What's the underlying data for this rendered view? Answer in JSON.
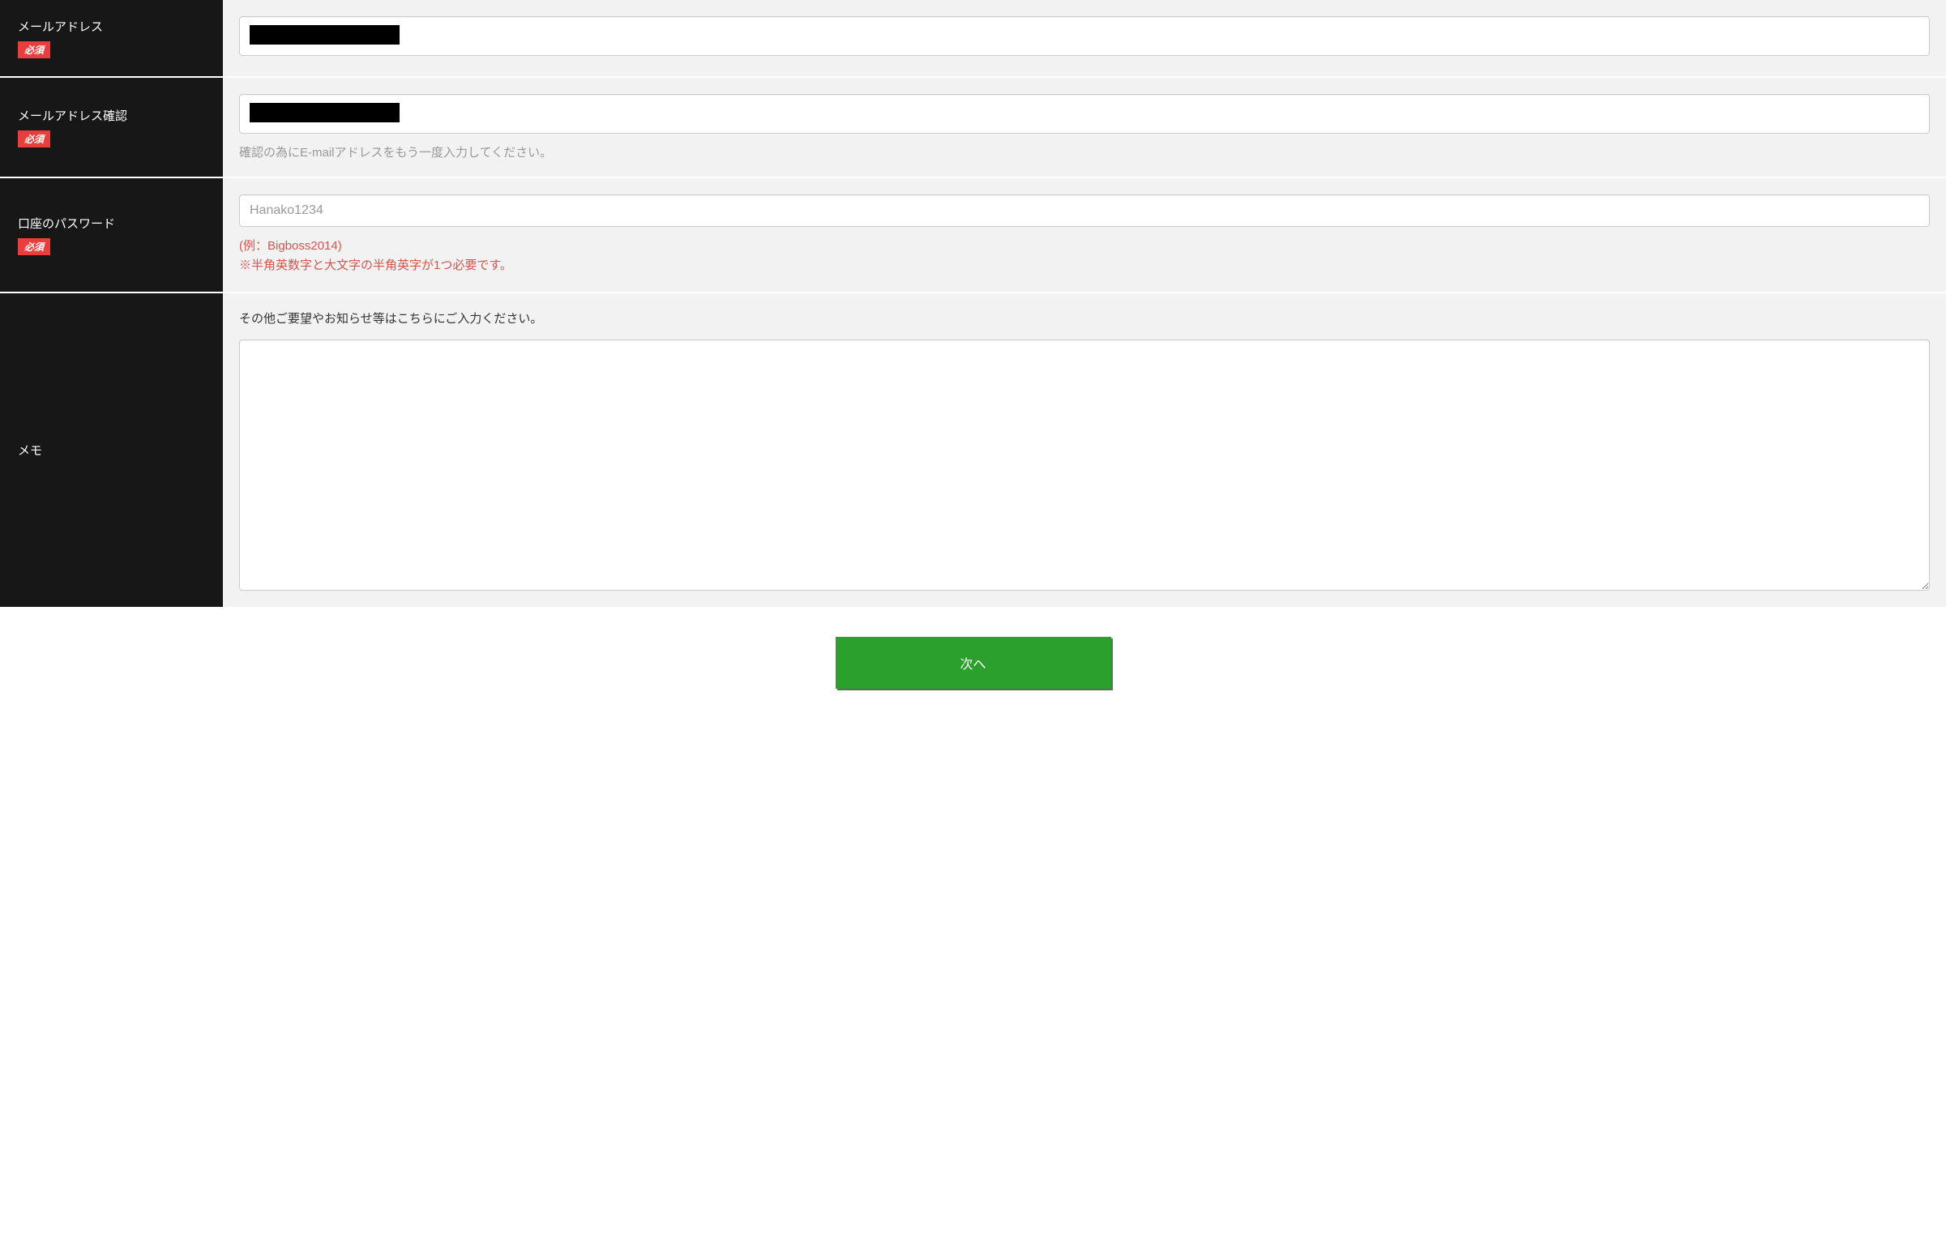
{
  "fields": {
    "email": {
      "label": "メールアドレス",
      "required_badge": "必須",
      "value": ""
    },
    "email_confirm": {
      "label": "メールアドレス確認",
      "required_badge": "必須",
      "value": "",
      "help": "確認の為にE-mailアドレスをもう一度入力してください。"
    },
    "password": {
      "label": "口座のパスワード",
      "required_badge": "必須",
      "placeholder": "Hanako1234",
      "hint_line1": "(例：Bigboss2014)",
      "hint_line2": "※半角英数字と大文字の半角英字が1つ必要です。"
    },
    "memo": {
      "label": "メモ",
      "description": "その他ご要望やお知らせ等はこちらにご入力ください。",
      "value": ""
    }
  },
  "buttons": {
    "next": "次へ"
  }
}
